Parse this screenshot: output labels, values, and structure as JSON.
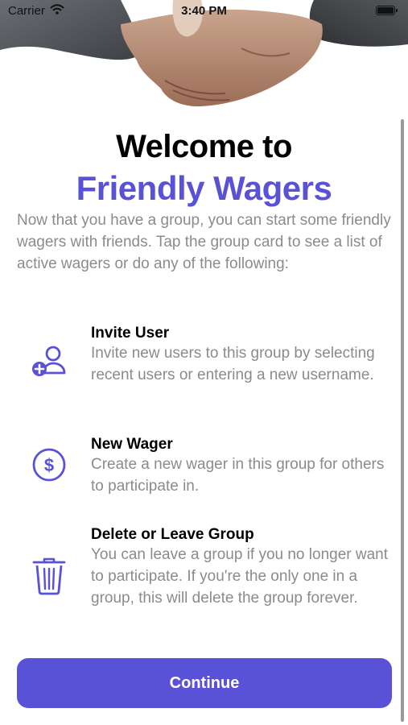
{
  "status_bar": {
    "carrier": "Carrier",
    "time": "3:40 PM"
  },
  "header": {
    "title_line1": "Welcome to",
    "title_line2": "Friendly Wagers"
  },
  "intro": "Now that you have a group, you can start some friendly wagers with friends.  Tap the group card to see a list of active wagers or do any of the following:",
  "features": [
    {
      "icon": "add-user-icon",
      "title": "Invite User",
      "description": "Invite new users to this group by selecting recent users or entering a new username."
    },
    {
      "icon": "dollar-circle-icon",
      "title": "New Wager",
      "description": "Create a new wager in this group for others to participate in."
    },
    {
      "icon": "trash-icon",
      "title": "Delete or Leave Group",
      "description": "You can leave a group if you no longer want to participate. If you're the only one in a group, this will delete the group forever."
    }
  ],
  "continue_label": "Continue",
  "colors": {
    "accent": "#5a52d6",
    "secondary_text": "#8b8b8b"
  }
}
